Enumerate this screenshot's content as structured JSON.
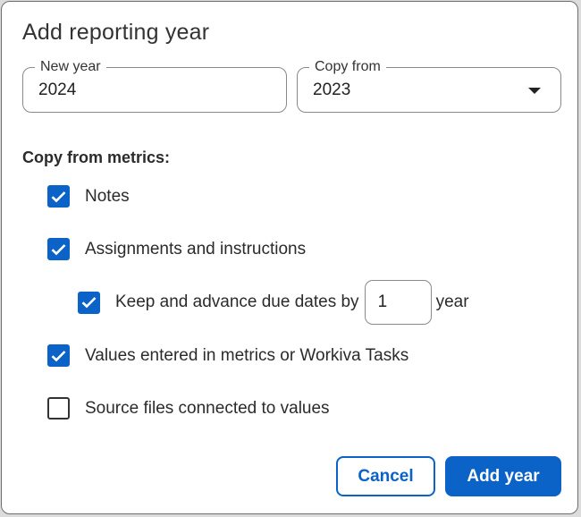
{
  "dialog": {
    "title": "Add reporting year",
    "new_year": {
      "label": "New year",
      "value": "2024"
    },
    "copy_from": {
      "label": "Copy from",
      "value": "2023"
    },
    "section_title": "Copy from metrics:",
    "options": {
      "notes": {
        "label": "Notes",
        "checked": true
      },
      "assignments": {
        "label": "Assignments and instructions",
        "checked": true
      },
      "keep_dates": {
        "label": "Keep and advance due dates by",
        "value": "1",
        "suffix": "year",
        "checked": true
      },
      "values_entered": {
        "label": "Values entered in metrics or Workiva Tasks",
        "checked": true
      },
      "source_files": {
        "label": "Source files connected to values",
        "checked": false
      }
    },
    "buttons": {
      "cancel": "Cancel",
      "add": "Add year"
    }
  },
  "colors": {
    "accent": "#0b62c7",
    "border": "#8a8a8a",
    "text": "#2b2b2b"
  },
  "icons": {
    "checkbox_checked": "checkmark-icon",
    "dropdown": "caret-down-icon"
  }
}
